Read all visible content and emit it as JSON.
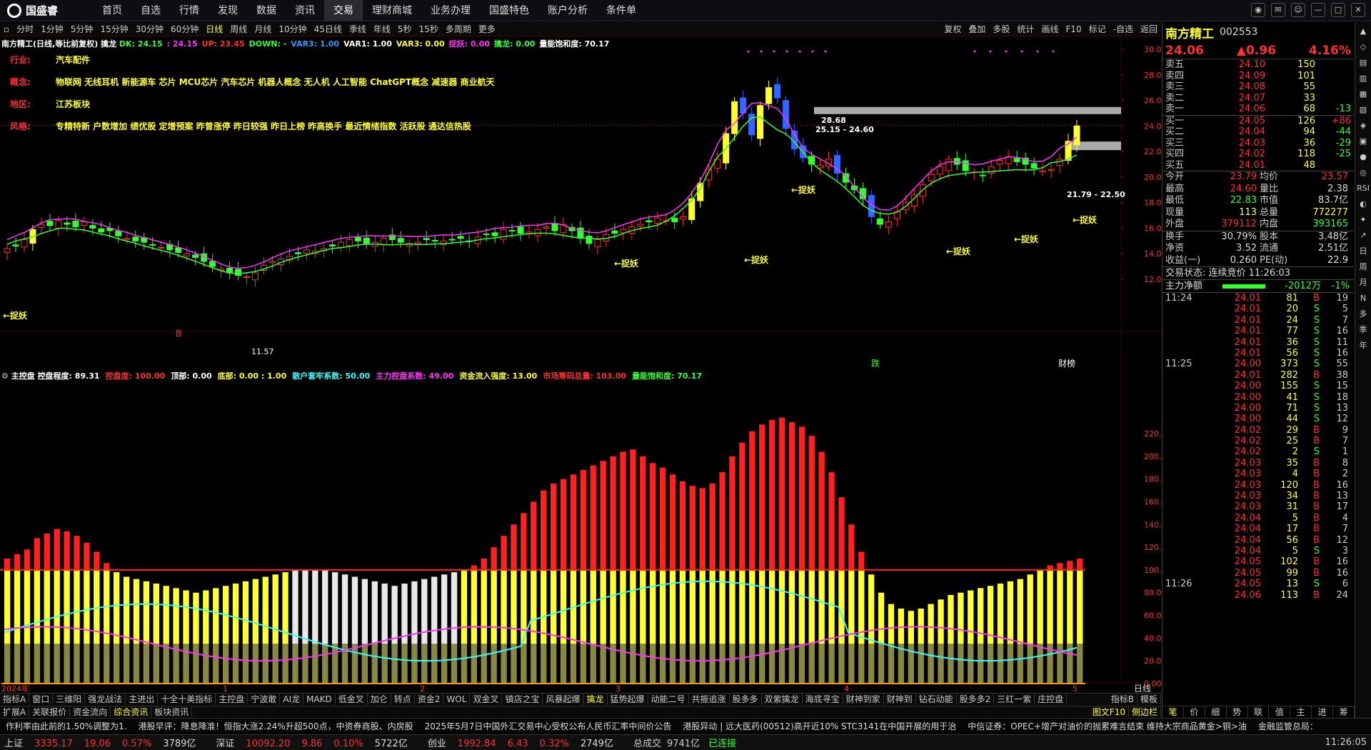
{
  "app": {
    "logo": "国盛睿"
  },
  "topnav": [
    "首页",
    "自选",
    "行情",
    "发现",
    "数据",
    "资讯",
    "交易",
    "理财商城",
    "业务办理",
    "国盛特色",
    "账户分析",
    "条件单"
  ],
  "topnav_active": 6,
  "periods": [
    "分时",
    "1分钟",
    "5分钟",
    "15分钟",
    "30分钟",
    "60分钟",
    "日线",
    "周线",
    "月线",
    "10分钟",
    "45日线",
    "季线",
    "年线",
    "5秒",
    "15秒",
    "多周期",
    "更多"
  ],
  "period_active": 6,
  "tools_right": [
    "复权",
    "叠加",
    "多股",
    "统计",
    "画线",
    "F10",
    "标记",
    "-自选",
    "返回"
  ],
  "main_indicator": {
    "stock": "南方精工(日线,等比前复权)",
    "name": "擒龙",
    "items": [
      {
        "t": "DK: 24.15",
        "c": "#33ff33"
      },
      {
        "t": ": 24.15",
        "c": "#ff33ff"
      },
      {
        "t": "UP: 23.45",
        "c": "#ff3030"
      },
      {
        "t": "DOWN: -",
        "c": "#33ff33"
      },
      {
        "t": "VAR3: 1.00",
        "c": "#3399ff"
      },
      {
        "t": "VAR1: 1.00",
        "c": "#ffffff"
      },
      {
        "t": "VAR3: 0.00",
        "c": "#ffff33"
      },
      {
        "t": "捉妖: 0.00",
        "c": "#ff33ff"
      },
      {
        "t": "擒龙: 0.00",
        "c": "#33ff33"
      },
      {
        "t": "量能饱和度: 70.17",
        "c": "#ffffff"
      }
    ]
  },
  "info": [
    {
      "label": "行业:",
      "value": "汽车配件"
    },
    {
      "label": "概念:",
      "value": "物联网 无线耳机 新能源车 芯片 MCU芯片 汽车芯片 机器人概念 无人机 人工智能 ChatGPT概念 减速器 商业航天"
    },
    {
      "label": "地区:",
      "value": "江苏板块"
    },
    {
      "label": "风格:",
      "value": "专精特新 户数增加 绩优股 定增预案 昨曾涨停 昨日较强 昨日上榜 昨高换手 最近情绪指数 活跃股 通达信热股"
    }
  ],
  "sub_indicator": {
    "name": "主控盘",
    "items": [
      {
        "t": "控盘程度: 89.31",
        "c": "#ffffff"
      },
      {
        "t": "控盘度: 100.00",
        "c": "#ff3030"
      },
      {
        "t": "顶部: 0.00",
        "c": "#ffffff"
      },
      {
        "t": "底部: 0.00 : 1.00",
        "c": "#ffff33"
      },
      {
        "t": "散户套牢系数: 50.00",
        "c": "#33ffff"
      },
      {
        "t": "主力控盘系数: 49.00",
        "c": "#ff33ff"
      },
      {
        "t": "资金流入强度: 13.00",
        "c": "#ffff33"
      },
      {
        "t": "市场筹码总量: 103.00",
        "c": "#ff3030"
      },
      {
        "t": "量能饱和度: 70.17",
        "c": "#33ff33"
      }
    ]
  },
  "chart_data": {
    "type": "candlestick",
    "price_axis": [
      "30.00",
      "28.00",
      "26.00",
      "24.00",
      "22.00",
      "20.00",
      "18.00",
      "16.00",
      "14.00",
      "12.00"
    ],
    "sub_axis": [
      "220.0",
      "200.0",
      "180.0",
      "160.0",
      "140.0",
      "120.0",
      "100.0",
      "80.00",
      "60.00",
      "40.00",
      "20.00",
      "0.00"
    ],
    "x_labels": [
      "2024年",
      "1",
      "2",
      "3",
      "4",
      "5"
    ],
    "annotations": [
      "捉妖",
      "28.68",
      "25.15 - 24.60",
      "21.79 - 22.50",
      "11.57",
      "B",
      "跌",
      "财榜"
    ],
    "closes": [
      14.4,
      14.6,
      15.1,
      15.9,
      16.3,
      16.2,
      16.6,
      16.3,
      16.1,
      16.5,
      16.0,
      15.7,
      15.8,
      15.4,
      15.2,
      15.0,
      14.9,
      14.7,
      14.5,
      14.3,
      14.1,
      14.0,
      13.7,
      13.4,
      13.0,
      12.8,
      12.5,
      12.3,
      12.2,
      12.5,
      13.1,
      13.4,
      13.6,
      13.8,
      14.0,
      14.3,
      14.2,
      14.4,
      14.6,
      14.9,
      15.1,
      15.0,
      14.8,
      14.9,
      15.2,
      15.1,
      14.9,
      14.8,
      14.9,
      15.1,
      15.0,
      15.0,
      15.1,
      15.2,
      15.0,
      15.3,
      15.5,
      15.4,
      15.9,
      15.8,
      15.6,
      15.7,
      15.9,
      16.1,
      15.8,
      16.3,
      15.8,
      15.2,
      14.8,
      15.1,
      15.5,
      15.6,
      15.9,
      16.1,
      16.3,
      16.5,
      16.8,
      16.6,
      16.5,
      16.9,
      18.3,
      19.5,
      20.6,
      21.4,
      23.4,
      25.9,
      25.0,
      23.3,
      25.6,
      27.0,
      26.2,
      23.8,
      22.2,
      21.5,
      21.0,
      20.9,
      21.4,
      20.3,
      19.6,
      19.0,
      18.3,
      16.9,
      16.3,
      16.5,
      17.3,
      18.0,
      18.6,
      19.4,
      20.2,
      20.8,
      21.4,
      21.0,
      20.5,
      20.4,
      20.1,
      20.8,
      21.3,
      21.6,
      21.2,
      21.0,
      20.7,
      20.5,
      20.6,
      21.4,
      22.8,
      24.0
    ],
    "sub_values": [
      110,
      114,
      118,
      128,
      132,
      136,
      134,
      130,
      124,
      116,
      106,
      98,
      94,
      92,
      90,
      88,
      86,
      84,
      82,
      80,
      82,
      84,
      86,
      88,
      90,
      92,
      94,
      96,
      98,
      100,
      100,
      100,
      100,
      98,
      96,
      94,
      92,
      90,
      88,
      86,
      88,
      90,
      92,
      94,
      96,
      98,
      100,
      104,
      110,
      120,
      130,
      140,
      150,
      160,
      170,
      176,
      180,
      184,
      188,
      192,
      196,
      200,
      204,
      206,
      200,
      194,
      190,
      184,
      178,
      174,
      172,
      176,
      186,
      200,
      212,
      222,
      228,
      232,
      234,
      230,
      226,
      218,
      204,
      186,
      164,
      140,
      116,
      96,
      80,
      70,
      66,
      64,
      66,
      70,
      74,
      78,
      80,
      82,
      84,
      86,
      88,
      90,
      92,
      96,
      100,
      104,
      106,
      108,
      110
    ]
  },
  "bottom_tabs": [
    "指标A",
    "窗口",
    "三维阳",
    "强龙战法",
    "主进出",
    "十全十美指标",
    "主控盘",
    "宁波敢",
    "AI龙",
    "MAKD",
    "低金叉",
    "加仑",
    "转点",
    "资金2",
    "WOL",
    "双金叉",
    "镇店之宝",
    "风暴起爆",
    "擒龙",
    "猛势起爆",
    "动能二号",
    "共振追涨",
    "股多多",
    "双紫擒龙",
    "海底寻宝",
    "财神到家",
    "财神到",
    "钻石动能",
    "股多多2",
    "三红一紫",
    "庄控盘"
  ],
  "bottom_tabs_active": 18,
  "bottom_tabs_right": [
    "指标B",
    "模板"
  ],
  "bottom_tabs2": [
    "扩展A",
    "关联报价",
    "资金流向",
    "综合资讯",
    "板块资讯"
  ],
  "bottom_tabs2_active": 3,
  "bottom_tabs2_right": [
    "图文F10",
    "侧边栏"
  ],
  "ticker": [
    "作利率由此前的1.50%调整为1.",
    "港股早评：降息降准！恒指大涨2.24%升超500点，中资券商股、内房股",
    "2025年5月7日中国外汇交易中心受权公布人民币汇率中间价公告",
    "港股异动 | 远大医药(00512)高开近10% STC3141在中国开展的用于治",
    "中信证券：OPEC+增产对油价的抛累难言结束 维持大宗商品黄金>铜>油",
    "金融监管总局："
  ],
  "status": [
    {
      "label": "上证",
      "v1": "3335.17",
      "v2": "19.06",
      "v3": "0.57%",
      "v4": "3789亿"
    },
    {
      "label": "深证",
      "v1": "10092.20",
      "v2": "9.86",
      "v3": "0.10%",
      "v4": "5722亿"
    },
    {
      "label": "创业",
      "v1": "1992.84",
      "v2": "6.43",
      "v3": "0.32%",
      "v4": "2749亿"
    }
  ],
  "status_extra": {
    "label": "总成交",
    "value": "9741亿",
    "conn": "已连接",
    "time": "11:26:05"
  },
  "quote": {
    "name": "南方精工",
    "code": "002553",
    "price": "24.06",
    "change": "▲0.96",
    "pct": "4.16%",
    "asks": [
      {
        "l": "卖五",
        "p": "24.10",
        "v": "150",
        "c": ""
      },
      {
        "l": "卖四",
        "p": "24.09",
        "v": "101",
        "c": ""
      },
      {
        "l": "卖三",
        "p": "24.08",
        "v": "55",
        "c": ""
      },
      {
        "l": "卖二",
        "p": "24.07",
        "v": "33",
        "c": ""
      },
      {
        "l": "卖一",
        "p": "24.06",
        "v": "68",
        "c": "-13"
      }
    ],
    "bids": [
      {
        "l": "买一",
        "p": "24.05",
        "v": "126",
        "c": "+86"
      },
      {
        "l": "买二",
        "p": "24.04",
        "v": "94",
        "c": "-44"
      },
      {
        "l": "买三",
        "p": "24.03",
        "v": "36",
        "c": "-29"
      },
      {
        "l": "买四",
        "p": "24.02",
        "v": "118",
        "c": "-25"
      },
      {
        "l": "买五",
        "p": "24.01",
        "v": "48",
        "c": ""
      }
    ],
    "stats": [
      {
        "l": "今开",
        "v": "23.79",
        "l2": "均价",
        "v2": "23.57"
      },
      {
        "l": "最高",
        "v": "24.60",
        "l2": "量比",
        "v2": "2.38"
      },
      {
        "l": "最低",
        "v": "22.83",
        "l2": "市值",
        "v2": "83.7亿"
      },
      {
        "l": "现量",
        "v": "113",
        "l2": "总量",
        "v2": "772277"
      },
      {
        "l": "外盘",
        "v": "379112",
        "l2": "内盘",
        "v2": "393165"
      }
    ],
    "stats2": [
      {
        "l": "换手",
        "v": "30.79%",
        "l2": "股本",
        "v2": "3.48亿"
      },
      {
        "l": "净资",
        "v": "3.52",
        "l2": "流通",
        "v2": "2.51亿"
      },
      {
        "l": "收益(一)",
        "v": "0.260",
        "l2": "PE(动)",
        "v2": "22.9"
      }
    ],
    "trade_state": "交易状态: 连续竞价 11:26:03",
    "main_flow_label": "主力净额",
    "main_flow": "-2012万",
    "main_flow_pct": "-1%",
    "ticks": [
      {
        "t": "11:24",
        "p": "24.01",
        "v": "81",
        "bs": "B",
        "n": "19"
      },
      {
        "t": "",
        "p": "24.01",
        "v": "20",
        "bs": "S",
        "n": "5"
      },
      {
        "t": "",
        "p": "24.01",
        "v": "24",
        "bs": "S",
        "n": "7"
      },
      {
        "t": "",
        "p": "24.01",
        "v": "77",
        "bs": "S",
        "n": "16"
      },
      {
        "t": "",
        "p": "24.01",
        "v": "36",
        "bs": "S",
        "n": "11"
      },
      {
        "t": "",
        "p": "24.01",
        "v": "56",
        "bs": "S",
        "n": "16"
      },
      {
        "t": "11:25",
        "p": "24.00",
        "v": "373",
        "bs": "S",
        "n": "55"
      },
      {
        "t": "",
        "p": "24.01",
        "v": "282",
        "bs": "B",
        "n": "38"
      },
      {
        "t": "",
        "p": "24.00",
        "v": "155",
        "bs": "S",
        "n": "15"
      },
      {
        "t": "",
        "p": "24.00",
        "v": "41",
        "bs": "S",
        "n": "18"
      },
      {
        "t": "",
        "p": "24.00",
        "v": "71",
        "bs": "S",
        "n": "13"
      },
      {
        "t": "",
        "p": "24.00",
        "v": "44",
        "bs": "S",
        "n": "12"
      },
      {
        "t": "",
        "p": "24.02",
        "v": "29",
        "bs": "B",
        "n": "9"
      },
      {
        "t": "",
        "p": "24.02",
        "v": "25",
        "bs": "B",
        "n": "7"
      },
      {
        "t": "",
        "p": "24.02",
        "v": "2",
        "bs": "S",
        "n": "1"
      },
      {
        "t": "",
        "p": "24.03",
        "v": "35",
        "bs": "B",
        "n": "8"
      },
      {
        "t": "",
        "p": "24.03",
        "v": "4",
        "bs": "B",
        "n": "2"
      },
      {
        "t": "",
        "p": "24.03",
        "v": "120",
        "bs": "B",
        "n": "16"
      },
      {
        "t": "",
        "p": "24.03",
        "v": "34",
        "bs": "B",
        "n": "13"
      },
      {
        "t": "",
        "p": "24.03",
        "v": "31",
        "bs": "B",
        "n": "17"
      },
      {
        "t": "",
        "p": "24.04",
        "v": "5",
        "bs": "B",
        "n": "4"
      },
      {
        "t": "",
        "p": "24.04",
        "v": "17",
        "bs": "B",
        "n": "7"
      },
      {
        "t": "",
        "p": "24.04",
        "v": "56",
        "bs": "B",
        "n": "12"
      },
      {
        "t": "",
        "p": "24.04",
        "v": "5",
        "bs": "S",
        "n": "3"
      },
      {
        "t": "",
        "p": "24.05",
        "v": "102",
        "bs": "B",
        "n": "16"
      },
      {
        "t": "",
        "p": "24.05",
        "v": "99",
        "bs": "B",
        "n": "16"
      },
      {
        "t": "11:26",
        "p": "24.05",
        "v": "13",
        "bs": "S",
        "n": "6"
      },
      {
        "t": "",
        "p": "24.06",
        "v": "113",
        "bs": "B",
        "n": "24"
      }
    ],
    "bottom_tabs": [
      "笔",
      "价",
      "细",
      "势",
      "联",
      "值",
      "主",
      "进",
      "筹"
    ]
  },
  "sidebar": [
    "▲",
    "◇",
    "▤",
    "▥",
    "▦",
    "▧",
    "◈",
    "▣",
    "●",
    "◎",
    "RSI",
    "◐",
    "✦",
    "↗",
    "日",
    "周",
    "月",
    "N",
    "多",
    "季",
    "年"
  ],
  "colors": {
    "up": "#ff3030",
    "down": "#33ff33",
    "yellow": "#ffff33",
    "blue": "#3366ff",
    "cyan": "#33ffff",
    "magenta": "#ff33ff"
  }
}
